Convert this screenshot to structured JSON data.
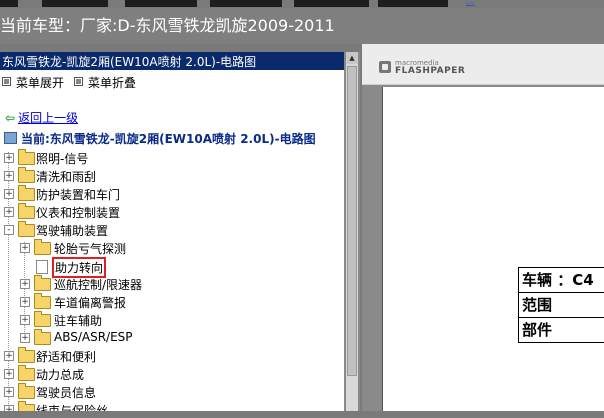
{
  "header": {
    "title": "当前车型：厂家:D-东风雪铁龙凯旋2009-2011",
    "top_link": "..."
  },
  "tree": {
    "title": "东风雪铁龙-凯旋2厢(EW10A喷射 2.0L)-电路图",
    "expand_label": "菜单展开",
    "collapse_label": "菜单折叠",
    "back_label": "返回上一级",
    "current_label": "当前:东风雪铁龙-凯旋2厢(EW10A喷射 2.0L)-电路图",
    "items": [
      {
        "label": "照明-信号",
        "sign": "+"
      },
      {
        "label": "清洗和雨刮",
        "sign": "+"
      },
      {
        "label": "防护装置和车门",
        "sign": "+"
      },
      {
        "label": "仪表和控制装置",
        "sign": "+"
      },
      {
        "label": "驾驶辅助装置",
        "sign": "-"
      },
      {
        "label": "轮胎亏气探测",
        "sign": "+"
      },
      {
        "label": "助力转向",
        "sign": ""
      },
      {
        "label": "巡航控制/限速器",
        "sign": "+"
      },
      {
        "label": "车道偏离警报",
        "sign": "+"
      },
      {
        "label": "驻车辅助",
        "sign": "+"
      },
      {
        "label": "ABS/ASR/ESP",
        "sign": "+"
      },
      {
        "label": "舒适和便利",
        "sign": "+"
      },
      {
        "label": "动力总成",
        "sign": "+"
      },
      {
        "label": "驾驶员信息",
        "sign": "+"
      },
      {
        "label": "线束与保险丝",
        "sign": "+"
      }
    ]
  },
  "viewer": {
    "brand_small": "macromedia",
    "brand_big": "FLASHPAPER",
    "doc_rows": [
      "车辆 ：C4",
      "范围",
      "部件"
    ]
  }
}
